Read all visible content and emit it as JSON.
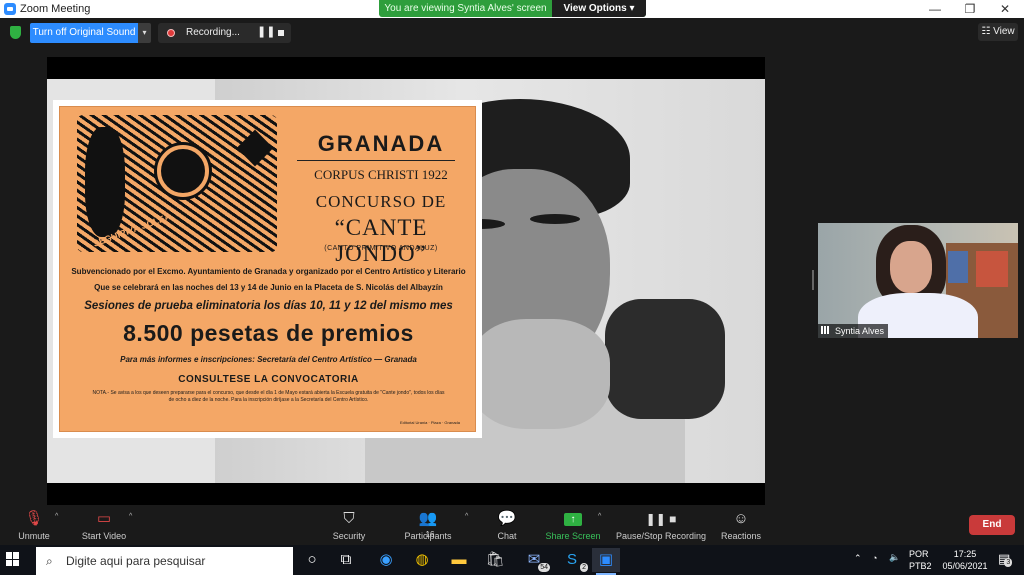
{
  "window": {
    "title": "Zoom Meeting",
    "minimize": "—",
    "restore": "❐",
    "close": "✕"
  },
  "share_banner": {
    "message": "You are viewing Syntia Alves' screen",
    "view_options": "View Options ▾"
  },
  "top_bar": {
    "original_sound": "Turn off Original Sound",
    "caret": "▾",
    "recording": "Recording...",
    "pause_glyph": "❚❚",
    "view": "☷ View"
  },
  "poster": {
    "art_label": "SEGUIRIYA  SOLEA",
    "title": "GRANADA",
    "line1": "CORPUS CHRISTI 1922",
    "line2": "CONCURSO DE",
    "line3": "“CANTE JONDO”",
    "line4": "(CANTO PRIMITIVO ANDALUZ)",
    "para1": "Subvencionado por el Excmo. Ayuntamiento de Granada y organizado por el Centro Artístico y Literario",
    "para2": "Que se celebrará en las noches del 13 y 14 de Junio en la Placeta de S. Nicolás del Albayzín",
    "para3": "Sesiones de prueba eliminatoria los días 10, 11 y 12 del mismo mes",
    "prize": "8.500 pesetas de premios",
    "info": "Para más informes e inscripciones: Secretaría del Centro Artístico — Granada",
    "consult": "CONSULTESE LA CONVOCATORIA",
    "note": "NOTA.- Se avisa a los que deseen prepararse para el concurso, que desde el día 1 de Mayo estará abierta la Escuela gratuita de \"Cante jondo\", todos los días de ocho a diez de la noche. Para la inscripción diríjase a la Secretaría del Centro Artístico.",
    "printer": "Editorial Urania · Plaza · Granada"
  },
  "participant": {
    "name": "Syntia Alves"
  },
  "toolbar": {
    "unmute": "Unmute",
    "start_video": "Start Video",
    "security": "Security",
    "participants": "Participants",
    "participants_count": "16",
    "chat": "Chat",
    "share_screen": "Share Screen",
    "pause_stop_recording": "Pause/Stop Recording",
    "reactions": "Reactions",
    "end": "End",
    "caret": "^"
  },
  "taskbar": {
    "search_placeholder": "Digite aqui para pesquisar",
    "mail_badge": "54",
    "skype_badge": "2",
    "lang_top": "POR",
    "lang_bottom": "PTB2",
    "time": "17:25",
    "date": "05/06/2021",
    "notif_badge": "3"
  },
  "colors": {
    "zoom_blue": "#2d8cff",
    "share_green": "#2e9e3c",
    "end_red": "#c93a3a",
    "poster_orange": "#f4a766"
  }
}
